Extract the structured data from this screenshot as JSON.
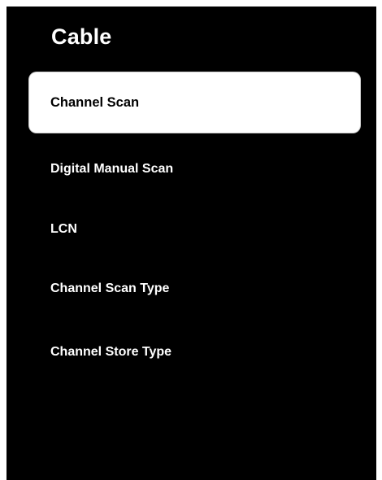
{
  "page": {
    "title": "Cable"
  },
  "menu": {
    "items": [
      {
        "label": "Channel Scan",
        "selected": true
      },
      {
        "label": "Digital Manual Scan",
        "selected": false
      },
      {
        "label": "LCN",
        "selected": false
      },
      {
        "label": "Channel Scan Type",
        "selected": false
      },
      {
        "label": "Channel Store Type",
        "selected": false
      }
    ]
  },
  "colors": {
    "background": "#000000",
    "text": "#ffffff",
    "selected_background": "#ffffff",
    "selected_text": "#000000"
  }
}
